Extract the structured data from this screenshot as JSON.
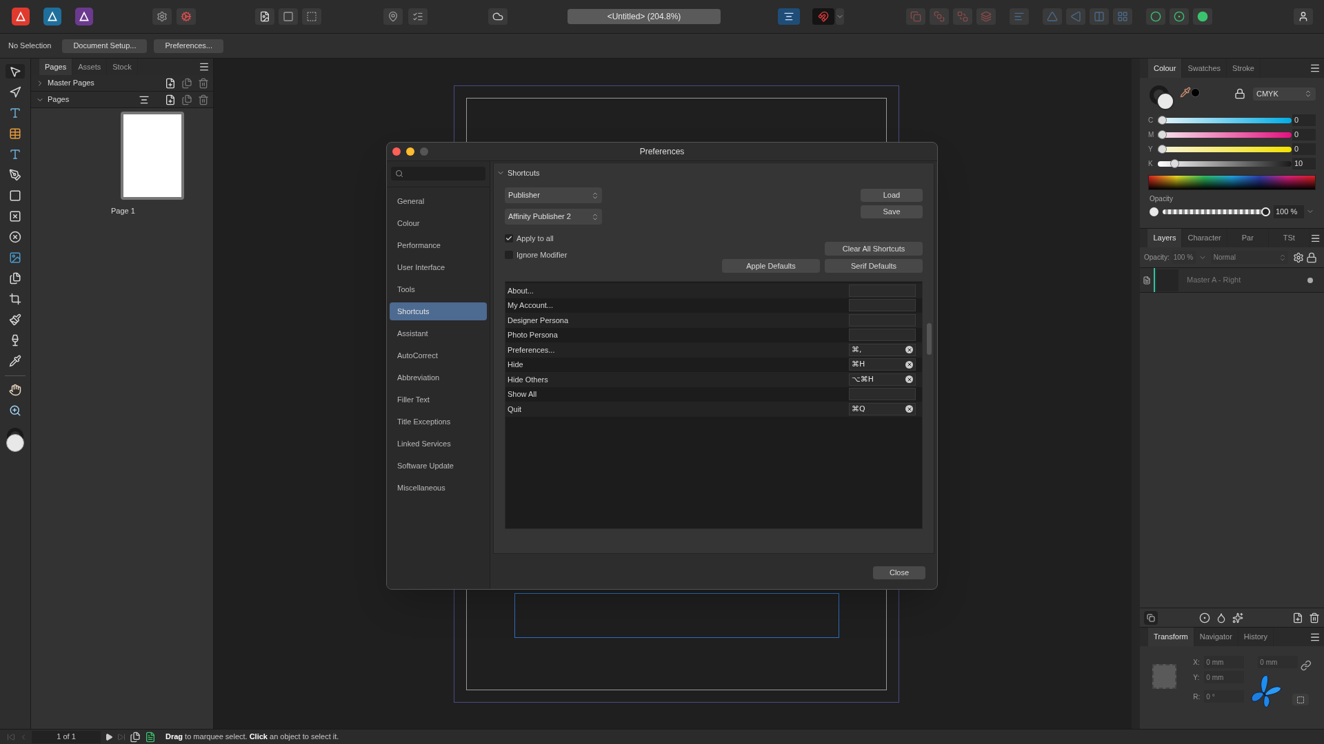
{
  "app_toolbar": {
    "document_title": "<Untitled> (204.8%)"
  },
  "context_bar": {
    "selection": "No Selection",
    "buttons": [
      "Document Setup...",
      "Preferences..."
    ]
  },
  "left_panel": {
    "tabs": [
      {
        "label": "Pages",
        "selected": true
      },
      {
        "label": "Assets",
        "selected": false
      },
      {
        "label": "Stock",
        "selected": false
      }
    ],
    "sections": [
      {
        "label": "Master Pages",
        "expanded": false
      },
      {
        "label": "Pages",
        "expanded": true
      }
    ],
    "pages": [
      {
        "label": "Page 1"
      }
    ]
  },
  "colour_panel": {
    "tabs": [
      {
        "label": "Colour",
        "selected": true
      },
      {
        "label": "Swatches",
        "selected": false
      },
      {
        "label": "Stroke",
        "selected": false
      }
    ],
    "model": "CMYK",
    "channels": [
      {
        "name": "C",
        "level": 0,
        "reading": "0"
      },
      {
        "name": "M",
        "level": 0,
        "reading": "0"
      },
      {
        "name": "Y",
        "level": 0,
        "reading": "0"
      },
      {
        "name": "K",
        "level": 0.1,
        "reading": "10"
      }
    ],
    "opacity_label": "Opacity",
    "opacity": {
      "level": 1,
      "reading": "100 %"
    }
  },
  "layers_panel": {
    "tabs": [
      {
        "label": "Layers",
        "selected": true
      },
      {
        "label": "Character",
        "selected": false
      },
      {
        "label": "Par",
        "selected": false
      },
      {
        "label": "TSt",
        "selected": false
      }
    ],
    "opacity_label": "Opacity:",
    "opacity": "100 %",
    "blend_mode": "Normal",
    "layers": [
      {
        "name": "Master A - Right"
      }
    ]
  },
  "transform_panel": {
    "tabs": [
      {
        "label": "Transform",
        "selected": true
      },
      {
        "label": "Navigator",
        "selected": false
      },
      {
        "label": "History",
        "selected": false
      }
    ],
    "fields": [
      {
        "label": "X:",
        "value": "0 mm"
      },
      {
        "label": "Y:",
        "value": "0 mm"
      },
      {
        "label": "R:",
        "value": "0 °"
      }
    ],
    "w_value": "0 mm"
  },
  "dialog": {
    "title": "Preferences",
    "categories": [
      {
        "label": "General",
        "selected": false
      },
      {
        "label": "Colour",
        "selected": false
      },
      {
        "label": "Performance",
        "selected": false
      },
      {
        "label": "User Interface",
        "selected": false
      },
      {
        "label": "Tools",
        "selected": false
      },
      {
        "label": "Shortcuts",
        "selected": true
      },
      {
        "label": "Assistant",
        "selected": false
      },
      {
        "label": "AutoCorrect",
        "selected": false
      },
      {
        "label": "Abbreviation",
        "selected": false
      },
      {
        "label": "Filler Text",
        "selected": false
      },
      {
        "label": "Title Exceptions",
        "selected": false
      },
      {
        "label": "Linked Services",
        "selected": false
      },
      {
        "label": "Software Update",
        "selected": false
      },
      {
        "label": "Miscellaneous",
        "selected": false
      }
    ],
    "section": "Shortcuts",
    "persona": "Publisher",
    "scheme": "Affinity Publisher 2",
    "load": "Load",
    "save": "Save",
    "clear_all": "Clear All Shortcuts",
    "apple_defaults": "Apple Defaults",
    "serif_defaults": "Serif Defaults",
    "options": [
      {
        "label": "Apply to all",
        "checked": true
      },
      {
        "label": "Ignore Modifier",
        "checked": false
      }
    ],
    "shortcuts": [
      {
        "command": "About..."
      },
      {
        "command": "My Account..."
      },
      {
        "command": "Designer Persona"
      },
      {
        "command": "Photo Persona"
      },
      {
        "command": "Preferences...",
        "keys": "⌘,"
      },
      {
        "command": "Hide",
        "keys": "⌘H"
      },
      {
        "command": "Hide Others",
        "keys": "⌥⌘H"
      },
      {
        "command": "Show All"
      },
      {
        "command": "Quit",
        "keys": "⌘Q"
      }
    ],
    "close": "Close"
  },
  "status_bar": {
    "page": "1 of 1",
    "hint": "**Drag** to marquee select. **Click** an object to select it."
  }
}
